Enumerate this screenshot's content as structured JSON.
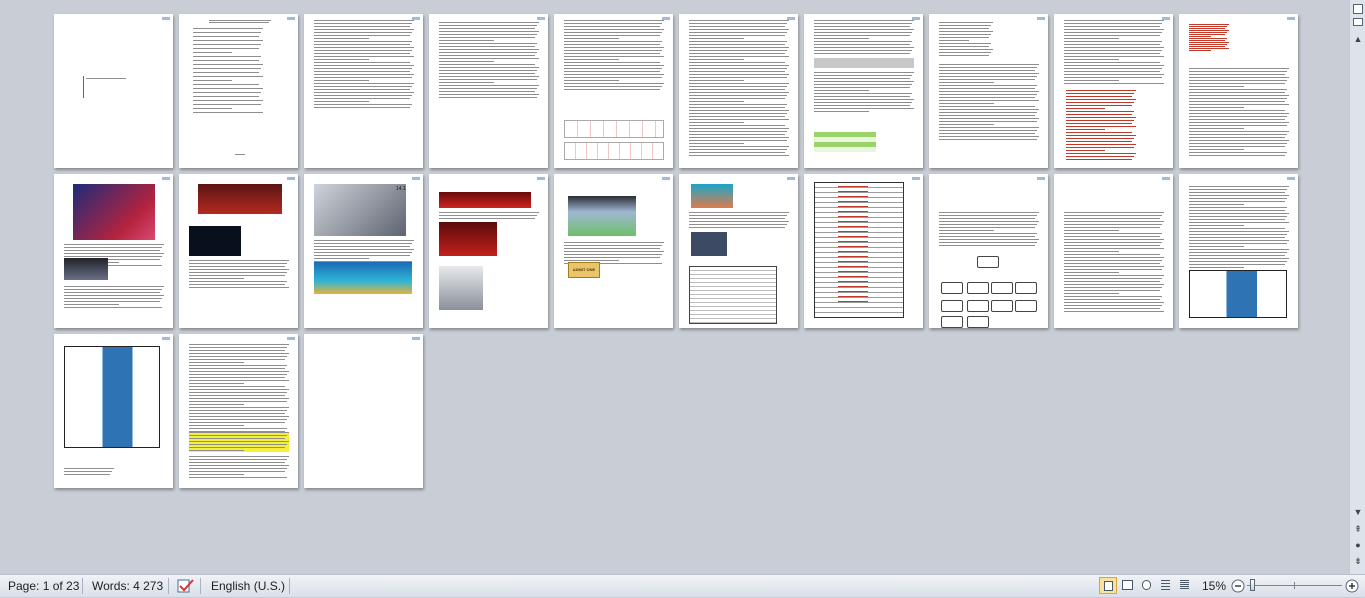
{
  "statusbar": {
    "page_indicator": "Page: 1 of 23",
    "word_count": "Words: 4 273",
    "language": "English (U.S.)",
    "zoom_level": "15%",
    "zoom_fraction": 0.15
  },
  "colors": {
    "workspace_bg": "#c9ced6",
    "accent_blue": "#2e74b5",
    "highlight_yellow": "#f3ef3a",
    "cinema_red": "#c0392b"
  },
  "icons": {
    "proofing": "spelling-check-icon",
    "zoom_out": "minus-icon",
    "zoom_in": "plus-icon",
    "scroll_up": "arrow-up-icon",
    "scroll_down": "arrow-down-icon"
  },
  "page_thumbnails": {
    "count": 23,
    "row_sizes": [
      10,
      10,
      3
    ]
  },
  "thumb_texts": {
    "admit_one": "ADMIT ONE",
    "page14_badge": "14.1",
    "dolby": "DOLBY ATMOS"
  }
}
